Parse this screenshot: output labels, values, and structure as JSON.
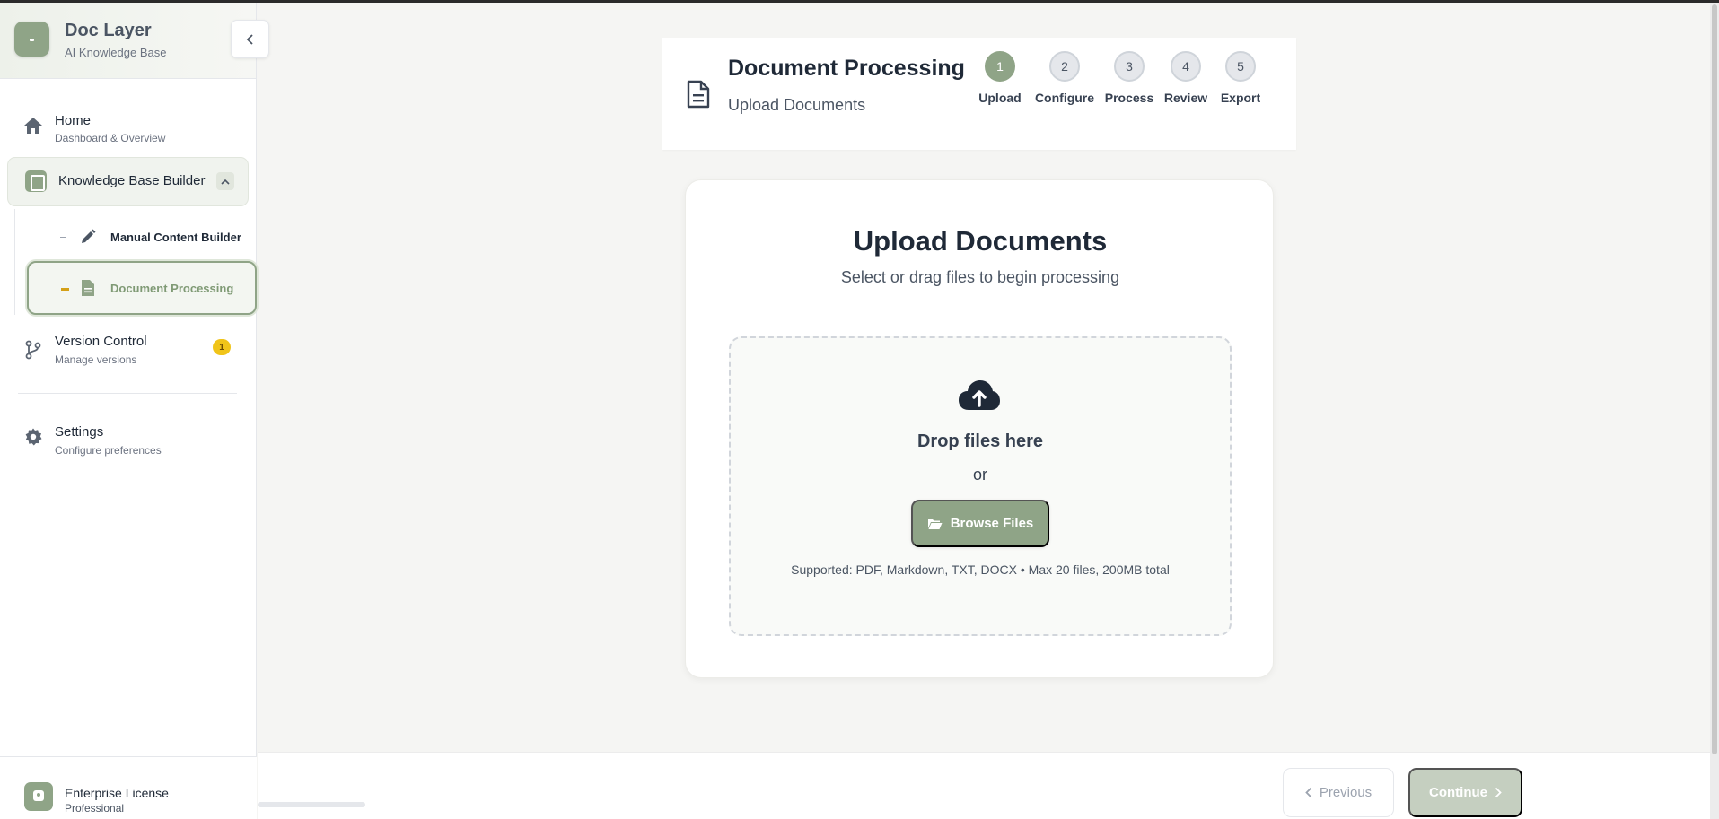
{
  "sidebar": {
    "brand": {
      "title": "Doc Layer",
      "subtitle": "AI Knowledge Base"
    },
    "nav": [
      {
        "title": "Home",
        "subtitle": "Dashboard & Overview",
        "icon": "home-icon"
      },
      {
        "title": "Knowledge Base Builder",
        "icon": "book-icon"
      },
      {
        "title": "Version Control",
        "subtitle": "Manage versions",
        "icon": "branch-icon",
        "badge": "1"
      },
      {
        "title": "Settings",
        "subtitle": "Configure preferences",
        "icon": "gear-icon"
      }
    ],
    "sub_items": [
      {
        "label": "Manual Content Builder",
        "icon": "pencil-icon"
      },
      {
        "label": "Document Processing",
        "icon": "file-icon",
        "active": true
      }
    ],
    "license": {
      "title": "Enterprise License",
      "subtitle": "Professional"
    }
  },
  "header": {
    "title": "Document Processing",
    "subtitle": "Upload Documents",
    "steps": [
      {
        "number": "1",
        "label": "Upload",
        "active": true
      },
      {
        "number": "2",
        "label": "Configure"
      },
      {
        "number": "3",
        "label": "Process"
      },
      {
        "number": "4",
        "label": "Review"
      },
      {
        "number": "5",
        "label": "Export"
      }
    ]
  },
  "upload": {
    "title": "Upload Documents",
    "subtitle": "Select or drag files to begin processing",
    "drop_text": "Drop files here",
    "or_text": "or",
    "browse_label": "Browse Files",
    "supported": "Supported: PDF, Markdown, TXT, DOCX • Max 20 files, 200MB total"
  },
  "footer": {
    "previous_label": "Previous",
    "continue_label": "Continue"
  },
  "colors": {
    "accent": "#8fa487",
    "badge": "#f0c419",
    "text": "#1f2937"
  }
}
